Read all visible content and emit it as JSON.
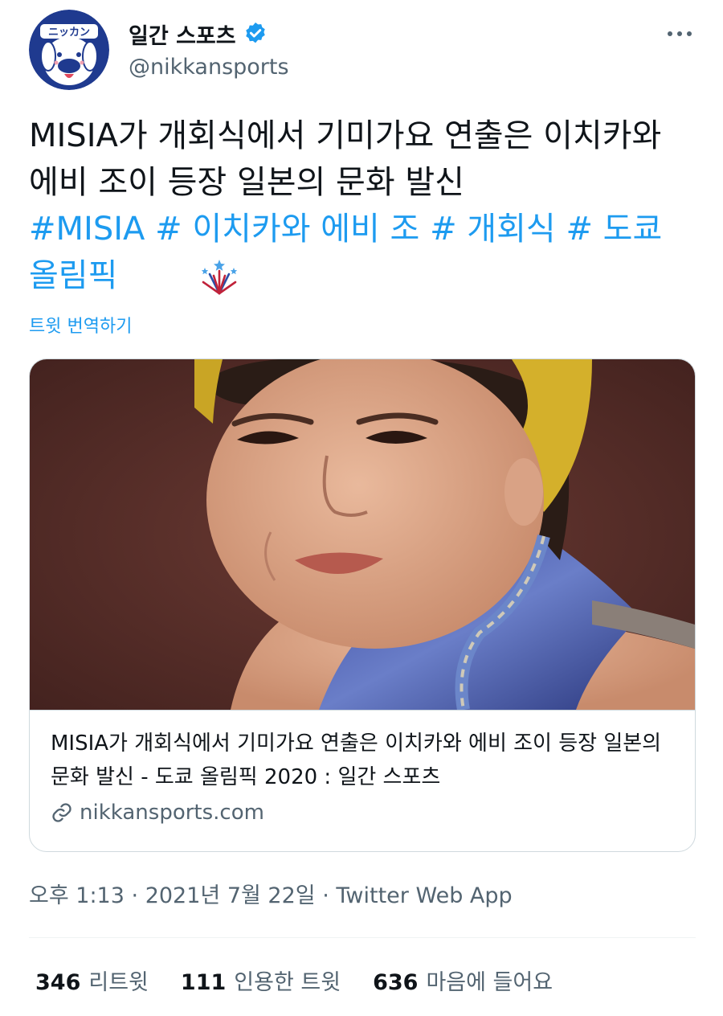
{
  "account": {
    "display_name": "일간 스포츠",
    "handle": "@nikkansports",
    "avatar_icon": "nikkan-dog-logo",
    "avatar_logo_text": "ニッカン",
    "verified_icon": "verified-badge-icon"
  },
  "more_icon": "more-options-icon",
  "tweet": {
    "text_prefix": "MISIA가 개회식에서 기미가요 연출은 이치카와 에비 조이 등장 일본의 문화 발신",
    "hashtags": [
      "#MISIA",
      "# 이치카와 에비 조",
      "# 개회식",
      "# 도쿄 올림픽"
    ],
    "emoji_icon": "fireworks-icon",
    "translate_label": "트윗 번역하기"
  },
  "card": {
    "image_alt": "MISIA",
    "title": "MISIA가 개회식에서 기미가요 연출은 이치카와 에비 조이 등장 일본의 문화 발신 - 도쿄 올림픽 2020 : 일간 스포츠",
    "domain": "nikkansports.com",
    "link_icon": "link-icon"
  },
  "meta": {
    "time": "오후 1:13",
    "date": "2021년 7월 22일",
    "separator": "·",
    "source": "Twitter Web App"
  },
  "stats": [
    {
      "count": "346",
      "label": "리트윗"
    },
    {
      "count": "111",
      "label": "인용한 트윗"
    },
    {
      "count": "636",
      "label": "마음에 들어요"
    }
  ],
  "colors": {
    "accent": "#1d9bf0",
    "text": "#0f1419",
    "secondary": "#536471",
    "border": "#cfd9de"
  }
}
